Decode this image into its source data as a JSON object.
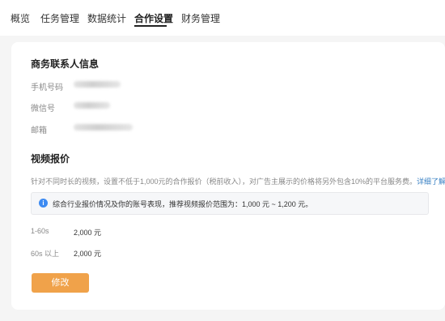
{
  "tabs": [
    {
      "label": "概览",
      "active": false
    },
    {
      "label": "任务管理",
      "active": false
    },
    {
      "label": "数据统计",
      "active": false
    },
    {
      "label": "合作设置",
      "active": true
    },
    {
      "label": "财务管理",
      "active": false
    }
  ],
  "contact": {
    "title": "商务联系人信息",
    "fields": [
      {
        "label": "手机号码"
      },
      {
        "label": "微信号"
      },
      {
        "label": "邮箱"
      }
    ]
  },
  "pricing": {
    "title": "视频报价",
    "description": "针对不同时长的视频，设置不低于1,000元的合作报价（税前收入），对广告主展示的价格将另外包含10%的平台服务费。",
    "description_link": "详细了解",
    "info_icon": "info-icon",
    "info_text": "综合行业报价情况及你的账号表现，推荐视频报价范围为：1,000 元 ~ 1,200 元。",
    "items": [
      {
        "label": "1-60s",
        "value": "2,000 元"
      },
      {
        "label": "60s 以上",
        "value": "2,000 元"
      }
    ],
    "edit_button": "修改"
  },
  "colors": {
    "accent_button": "#f0a24a",
    "link": "#3b82c4",
    "info_icon": "#3d8bf2"
  }
}
